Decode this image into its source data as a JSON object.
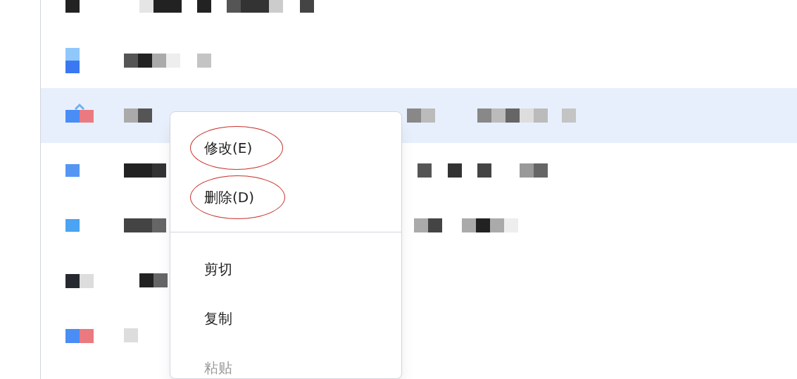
{
  "list": {
    "rows": [
      {
        "kind": "dark",
        "selected": false
      },
      {
        "kind": "stack",
        "selected": false
      },
      {
        "kind": "split-caret",
        "selected": true
      },
      {
        "kind": "blue",
        "selected": false
      },
      {
        "kind": "sky",
        "selected": false
      },
      {
        "kind": "dark-pair",
        "selected": false
      },
      {
        "kind": "split",
        "selected": false
      }
    ]
  },
  "context_menu": {
    "items": [
      {
        "kind": "item",
        "label": "修改(E)",
        "circled": true,
        "disabled": false
      },
      {
        "kind": "item",
        "label": "删除(D)",
        "circled": true,
        "disabled": false
      },
      {
        "kind": "divider"
      },
      {
        "kind": "item",
        "label": "剪切",
        "circled": false,
        "disabled": false
      },
      {
        "kind": "item",
        "label": "复制",
        "circled": false,
        "disabled": false
      },
      {
        "kind": "item",
        "label": "粘贴",
        "circled": false,
        "disabled": true
      }
    ]
  }
}
